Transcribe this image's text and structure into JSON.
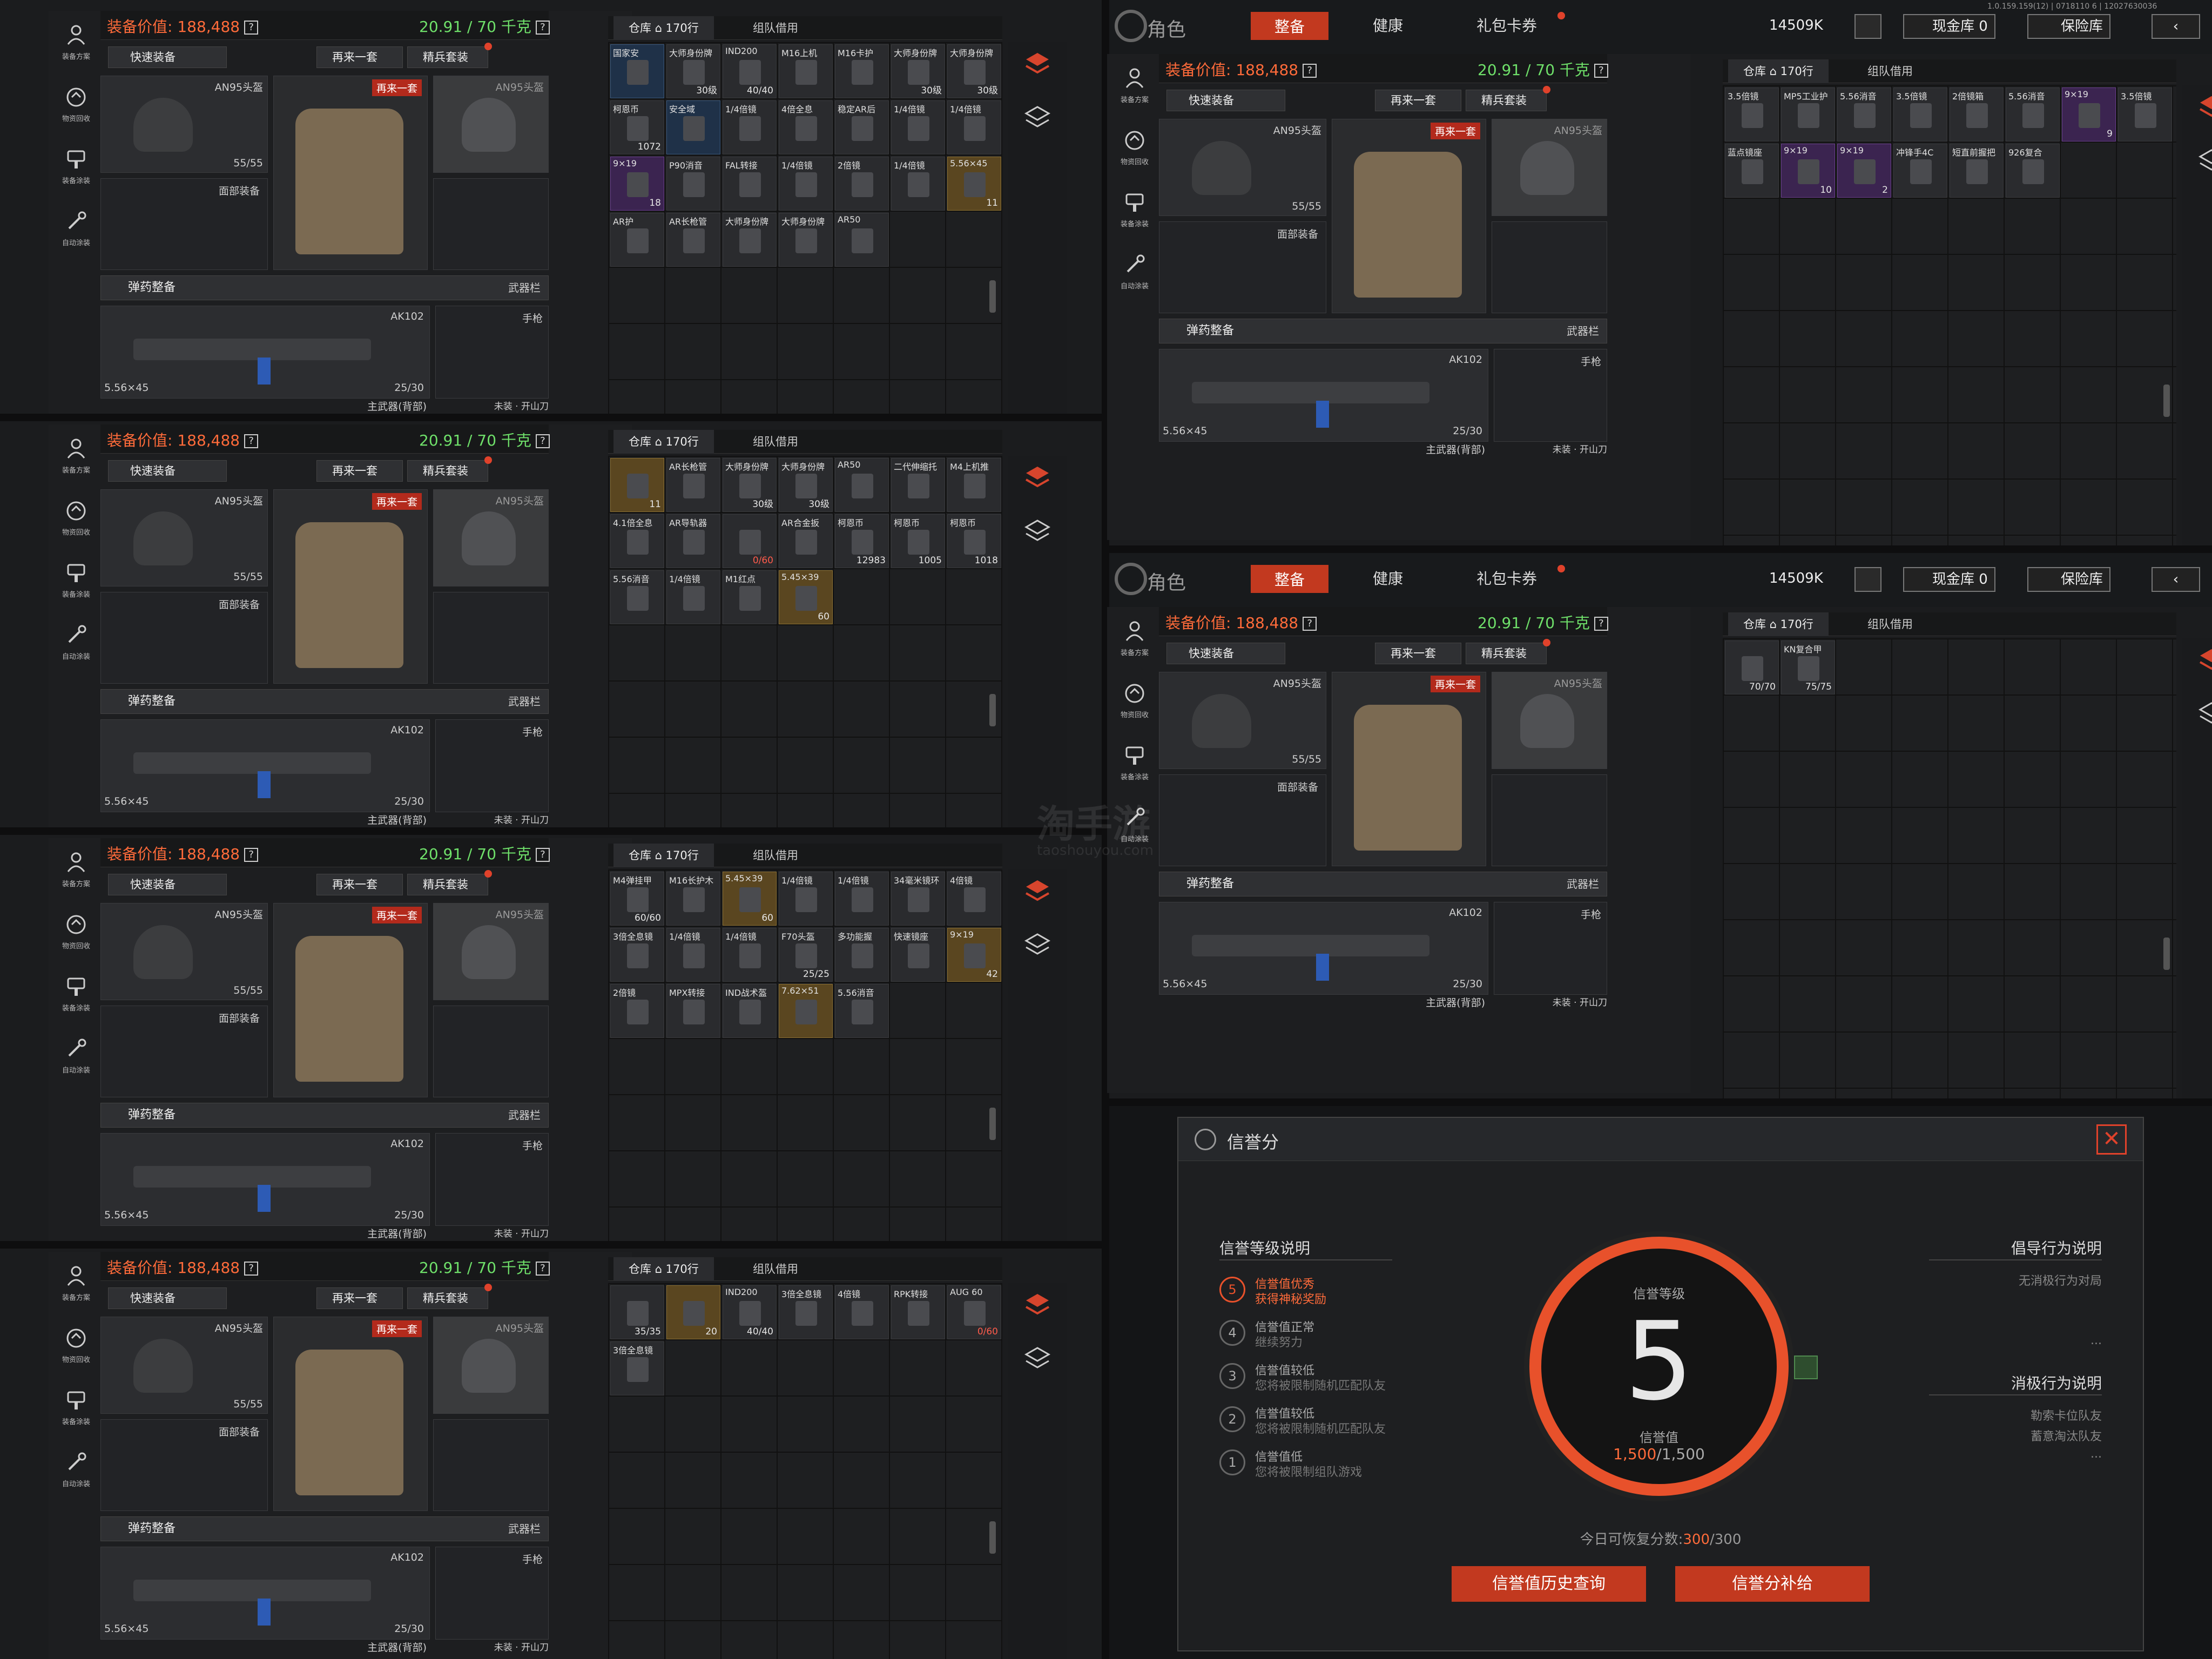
{
  "common": {
    "value_label": "装备价值: 188,488",
    "weight_label": "20.91 / 70 千克",
    "help": "?",
    "quick_equip": "快速装备",
    "again": "再来一套",
    "elite": "精兵套装",
    "again_tag": "再来一套",
    "helmet": "AN95头盔",
    "helmet_dur": "55/55",
    "face": "面部装备",
    "ammo_sort": "弹药整备",
    "weapon_bar": "武器栏",
    "rifle": "AK102",
    "caliber": "5.56×45",
    "mag": "25/30",
    "primary": "主武器(背部)",
    "pistol": "手枪",
    "melee": "未装 · 开山刀",
    "warehouse_tab": "仓库 ⌂ 170行",
    "team_tab": "组队借用"
  },
  "side_buttons": [
    {
      "label": "装备方案",
      "icon": "loadout-icon"
    },
    {
      "label": "物资回收",
      "icon": "recycle-icon"
    },
    {
      "label": "装备涂装",
      "icon": "paint-icon"
    },
    {
      "label": "自动涂装",
      "icon": "auto-paint-icon"
    }
  ],
  "top": {
    "role": "角色",
    "tabs": [
      "整备",
      "健康",
      "礼包卡券"
    ],
    "currency": "14509K",
    "cash_vault": "现金库 0",
    "safe": "保险库",
    "version1": "1.0.159.159(12) | 0718110 6 | 12027630036",
    "version2": "1.0.159.159(12) | 0718110 7 | 12027630036"
  },
  "grids": {
    "g1": [
      {
        "t": "国家安",
        "c": "",
        "k": "blu"
      },
      {
        "t": "大师身份牌",
        "c": "30级",
        "k": ""
      },
      {
        "t": "IND200",
        "c": "40/40",
        "k": ""
      },
      {
        "t": "M16上机",
        "c": "",
        "k": ""
      },
      {
        "t": "M16卡护",
        "c": "",
        "k": ""
      },
      {
        "t": "大师身份牌",
        "c": "30级",
        "k": ""
      },
      {
        "t": "大师身份牌",
        "c": "30级",
        "k": ""
      },
      {
        "t": "柯恩币",
        "c": "1072",
        "k": ""
      },
      {
        "t": "安全域",
        "c": "",
        "k": "blu"
      },
      {
        "t": "1/4倍镜",
        "c": "",
        "k": ""
      },
      {
        "t": "4倍全息",
        "c": "",
        "k": ""
      },
      {
        "t": "稳定AR后",
        "c": "",
        "k": ""
      },
      {
        "t": "1/4倍镜",
        "c": "",
        "k": ""
      },
      {
        "t": "1/4倍镜",
        "c": "",
        "k": ""
      },
      {
        "t": "9×19",
        "c": "18",
        "k": "pur"
      },
      {
        "t": "P90消音",
        "c": "",
        "k": ""
      },
      {
        "t": "FAL转接",
        "c": "",
        "k": ""
      },
      {
        "t": "1/4倍镜",
        "c": "",
        "k": ""
      },
      {
        "t": "2倍镜",
        "c": "",
        "k": ""
      },
      {
        "t": "1/4倍镜",
        "c": "",
        "k": ""
      },
      {
        "t": "5.56×45",
        "c": "11",
        "k": "gold"
      },
      {
        "t": "AR护",
        "c": "",
        "k": ""
      },
      {
        "t": "AR长枪管",
        "c": "",
        "k": ""
      },
      {
        "t": "大师身份牌",
        "c": "",
        "k": ""
      },
      {
        "t": "大师身份牌",
        "c": "",
        "k": ""
      },
      {
        "t": "AR50",
        "c": "",
        "k": ""
      }
    ],
    "g2": [
      {
        "t": "",
        "c": "11",
        "k": "gold"
      },
      {
        "t": "AR长枪管",
        "c": "",
        "k": ""
      },
      {
        "t": "大师身份牌",
        "c": "30级",
        "k": ""
      },
      {
        "t": "大师身份牌",
        "c": "30级",
        "k": ""
      },
      {
        "t": "AR50",
        "c": "",
        "k": ""
      },
      {
        "t": "二代伸缩托",
        "c": "",
        "k": ""
      },
      {
        "t": "M4上机推",
        "c": "",
        "k": ""
      },
      {
        "t": "4.1倍全息",
        "c": "",
        "k": ""
      },
      {
        "t": "AR导轨器",
        "c": "",
        "k": ""
      },
      {
        "t": "",
        "c": "0/60",
        "k": ""
      },
      {
        "t": "AR合金扳",
        "c": "",
        "k": ""
      },
      {
        "t": "柯恩币",
        "c": "12983",
        "k": ""
      },
      {
        "t": "柯恩币",
        "c": "1005",
        "k": ""
      },
      {
        "t": "柯恩币",
        "c": "1018",
        "k": ""
      },
      {
        "t": "5.56消音",
        "c": "",
        "k": ""
      },
      {
        "t": "1/4倍镜",
        "c": "",
        "k": ""
      },
      {
        "t": "M1红点",
        "c": "",
        "k": ""
      },
      {
        "t": "5.45×39",
        "c": "60",
        "k": "gold"
      }
    ],
    "g3": [
      {
        "t": "M4弹挂甲",
        "c": "60/60",
        "k": ""
      },
      {
        "t": "M16长护木",
        "c": "",
        "k": ""
      },
      {
        "t": "5.45×39",
        "c": "60",
        "k": "gold"
      },
      {
        "t": "1/4倍镜",
        "c": "",
        "k": ""
      },
      {
        "t": "1/4倍镜",
        "c": "",
        "k": ""
      },
      {
        "t": "34毫米镜环",
        "c": "",
        "k": ""
      },
      {
        "t": "4倍镜",
        "c": "",
        "k": ""
      },
      {
        "t": "3倍全息镜",
        "c": "",
        "k": ""
      },
      {
        "t": "1/4倍镜",
        "c": "",
        "k": ""
      },
      {
        "t": "1/4倍镜",
        "c": "",
        "k": ""
      },
      {
        "t": "F70头盔",
        "c": "25/25",
        "k": ""
      },
      {
        "t": "多功能握",
        "c": "",
        "k": ""
      },
      {
        "t": "快速镜座",
        "c": "",
        "k": ""
      },
      {
        "t": "9×19",
        "c": "42",
        "k": "gold"
      },
      {
        "t": "2倍镜",
        "c": "",
        "k": ""
      },
      {
        "t": "MPX转接",
        "c": "",
        "k": ""
      },
      {
        "t": "IND战术盔",
        "c": "",
        "k": ""
      },
      {
        "t": "7.62×51",
        "c": "",
        "k": "gold"
      },
      {
        "t": "5.56消音",
        "c": "",
        "k": ""
      }
    ],
    "g4": [
      {
        "t": "",
        "c": "35/35",
        "k": ""
      },
      {
        "t": "",
        "c": "20",
        "k": "gold"
      },
      {
        "t": "IND200",
        "c": "40/40",
        "k": ""
      },
      {
        "t": "3倍全息镜",
        "c": "",
        "k": ""
      },
      {
        "t": "4倍镜",
        "c": "",
        "k": ""
      },
      {
        "t": "RPK转接",
        "c": "",
        "k": ""
      },
      {
        "t": "AUG 60",
        "c": "0/60",
        "k": ""
      },
      {
        "t": "3倍全息镜",
        "c": "",
        "k": ""
      }
    ],
    "g5": [
      {
        "t": "3.5倍镜",
        "c": "",
        "k": ""
      },
      {
        "t": "MP5工业护",
        "c": "",
        "k": ""
      },
      {
        "t": "5.56消音",
        "c": "",
        "k": ""
      },
      {
        "t": "3.5倍镜",
        "c": "",
        "k": ""
      },
      {
        "t": "2倍镜箱",
        "c": "",
        "k": ""
      },
      {
        "t": "5.56消音",
        "c": "",
        "k": ""
      },
      {
        "t": "9×19",
        "c": "9",
        "k": "pur"
      },
      {
        "t": "3.5倍镜",
        "c": "",
        "k": ""
      },
      {
        "t": "蓝点镜座",
        "c": "",
        "k": ""
      },
      {
        "t": "9×19",
        "c": "10",
        "k": "pur"
      },
      {
        "t": "9×19",
        "c": "2",
        "k": "pur"
      },
      {
        "t": "冲锋手4C",
        "c": "",
        "k": ""
      },
      {
        "t": "短直前握把",
        "c": "",
        "k": ""
      },
      {
        "t": "926复合",
        "c": "",
        "k": ""
      }
    ],
    "g6": [
      {
        "t": "",
        "c": "70/70",
        "k": ""
      },
      {
        "t": "KN复合甲",
        "c": "75/75",
        "k": ""
      }
    ]
  },
  "credit": {
    "title": "信誉分",
    "levels_title": "信誉等级说明",
    "levels": [
      {
        "n": "5",
        "a": "信誉值优秀",
        "b": "获得神秘奖励"
      },
      {
        "n": "4",
        "a": "信誉值正常",
        "b": "继续努力"
      },
      {
        "n": "3",
        "a": "信誉值较低",
        "b": "您将被限制随机匹配队友"
      },
      {
        "n": "2",
        "a": "信誉值较低",
        "b": "您将被限制随机匹配队友"
      },
      {
        "n": "1",
        "a": "信誉值低",
        "b": "您将被限制组队游戏"
      }
    ],
    "level_label": "信誉等级",
    "level": "5",
    "score_label": "信誉值",
    "score": "1,500",
    "score_max": "/1,500",
    "positive_title": "倡导行为说明",
    "positive_desc": "无消极行为对局",
    "negative_title": "消极行为说明",
    "negative_items": [
      "勒索卡位队友",
      "蓄意淘汰队友"
    ],
    "ellipsis": "...",
    "recover_label": "今日可恢复分数:",
    "recover_value": "300",
    "recover_max": "/300",
    "history_btn": "信誉值历史查询",
    "supply_btn": "信誉分补给"
  },
  "watermark": {
    "main": "淘手游",
    "sub": "taoshouyou.com"
  },
  "colors": {
    "accent": "#c2391f",
    "value": "#ff6b3a",
    "weight": "#6fe06a"
  }
}
